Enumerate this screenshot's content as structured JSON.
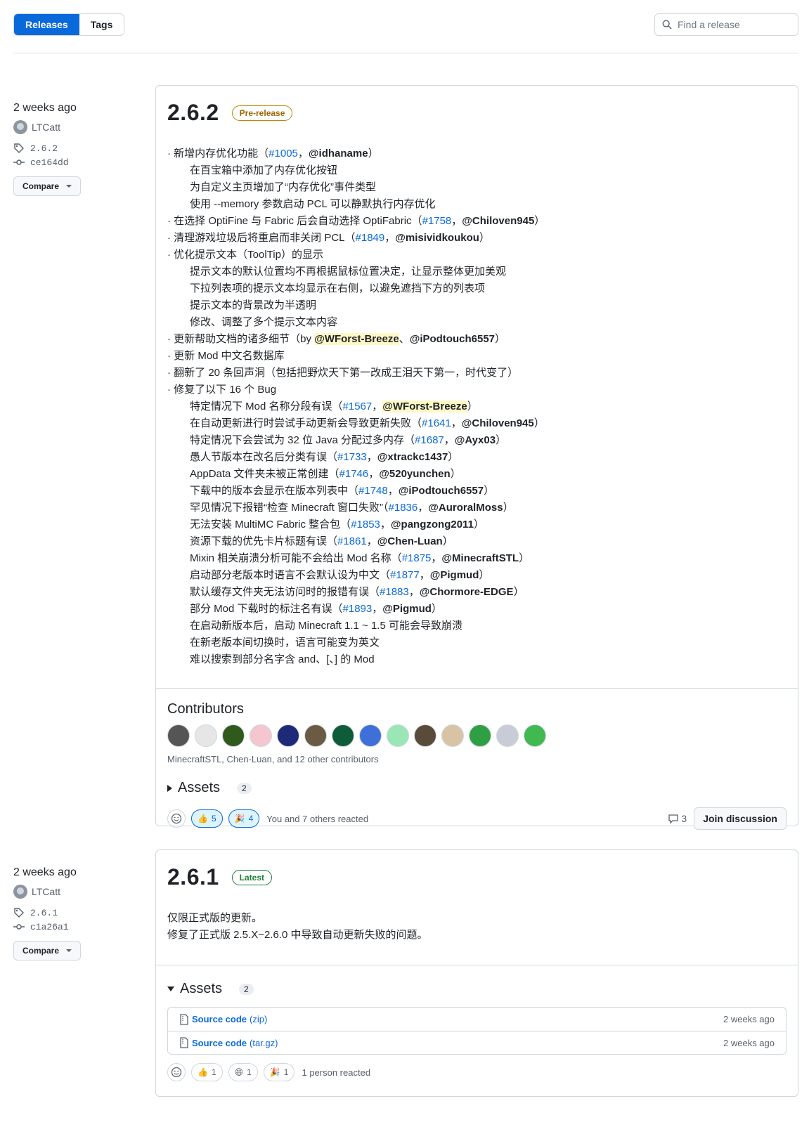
{
  "tabs": {
    "releases": "Releases",
    "tags": "Tags"
  },
  "search": {
    "placeholder": "Find a release"
  },
  "r1": {
    "time": "2 weeks ago",
    "author": "LTCatt",
    "tag": "2.6.2",
    "commit": "ce164dd",
    "compare": "Compare",
    "version": "2.6.2",
    "badge": "Pre-release",
    "notes": [
      {
        "indent": false,
        "parts": [
          {
            "t": "· 新增内存优化功能（"
          },
          {
            "t": "#1005",
            "k": "link"
          },
          {
            "t": "，"
          },
          {
            "t": "@idhaname",
            "k": "user"
          },
          {
            "t": "）"
          }
        ]
      },
      {
        "indent": true,
        "parts": [
          {
            "t": "在百宝箱中添加了内存优化按钮"
          }
        ]
      },
      {
        "indent": true,
        "parts": [
          {
            "t": "为自定义主页增加了“内存优化”事件类型"
          }
        ]
      },
      {
        "indent": true,
        "parts": [
          {
            "t": "使用 --memory 参数启动 PCL 可以静默执行内存优化"
          }
        ]
      },
      {
        "indent": false,
        "parts": [
          {
            "t": "· 在选择 OptiFine 与 Fabric 后会自动选择 OptiFabric（"
          },
          {
            "t": "#1758",
            "k": "link"
          },
          {
            "t": "，"
          },
          {
            "t": "@Chiloven945",
            "k": "user"
          },
          {
            "t": "）"
          }
        ]
      },
      {
        "indent": false,
        "parts": [
          {
            "t": "· 清理游戏垃圾后将重启而非关闭 PCL（"
          },
          {
            "t": "#1849",
            "k": "link"
          },
          {
            "t": "，"
          },
          {
            "t": "@misividkoukou",
            "k": "user"
          },
          {
            "t": "）"
          }
        ]
      },
      {
        "indent": false,
        "parts": [
          {
            "t": "· 优化提示文本（ToolTip）的显示"
          }
        ]
      },
      {
        "indent": true,
        "parts": [
          {
            "t": "提示文本的默认位置均不再根据鼠标位置决定，让显示整体更加美观"
          }
        ]
      },
      {
        "indent": true,
        "parts": [
          {
            "t": "下拉列表项的提示文本均显示在右侧，以避免遮挡下方的列表项"
          }
        ]
      },
      {
        "indent": true,
        "parts": [
          {
            "t": "提示文本的背景改为半透明"
          }
        ]
      },
      {
        "indent": true,
        "parts": [
          {
            "t": "修改、调整了多个提示文本内容"
          }
        ]
      },
      {
        "indent": false,
        "parts": [
          {
            "t": "· 更新帮助文档的诸多细节（by "
          },
          {
            "t": "@WForst-Breeze",
            "k": "hl"
          },
          {
            "t": "、"
          },
          {
            "t": "@iPodtouch6557",
            "k": "user"
          },
          {
            "t": "）"
          }
        ]
      },
      {
        "indent": false,
        "parts": [
          {
            "t": "· 更新 Mod 中文名数据库"
          }
        ]
      },
      {
        "indent": false,
        "parts": [
          {
            "t": "· 翻新了 20 条回声洞（包括把野炊天下第一改成王泪天下第一，时代变了）"
          }
        ]
      },
      {
        "indent": false,
        "parts": [
          {
            "t": "· 修复了以下 16 个 Bug"
          }
        ]
      },
      {
        "indent": true,
        "parts": [
          {
            "t": "特定情况下 Mod 名称分段有误（"
          },
          {
            "t": "#1567",
            "k": "link"
          },
          {
            "t": "，"
          },
          {
            "t": "@WForst-Breeze",
            "k": "hl"
          },
          {
            "t": "）"
          }
        ]
      },
      {
        "indent": true,
        "parts": [
          {
            "t": "在自动更新进行时尝试手动更新会导致更新失败（"
          },
          {
            "t": "#1641",
            "k": "link"
          },
          {
            "t": "，"
          },
          {
            "t": "@Chiloven945",
            "k": "user"
          },
          {
            "t": "）"
          }
        ]
      },
      {
        "indent": true,
        "parts": [
          {
            "t": "特定情况下会尝试为 32 位 Java 分配过多内存（"
          },
          {
            "t": "#1687",
            "k": "link"
          },
          {
            "t": "，"
          },
          {
            "t": "@Ayx03",
            "k": "user"
          },
          {
            "t": "）"
          }
        ]
      },
      {
        "indent": true,
        "parts": [
          {
            "t": "愚人节版本在改名后分类有误（"
          },
          {
            "t": "#1733",
            "k": "link"
          },
          {
            "t": "，"
          },
          {
            "t": "@xtrackc1437",
            "k": "user"
          },
          {
            "t": "）"
          }
        ]
      },
      {
        "indent": true,
        "parts": [
          {
            "t": "AppData 文件夹未被正常创建（"
          },
          {
            "t": "#1746",
            "k": "link"
          },
          {
            "t": "，"
          },
          {
            "t": "@520yunchen",
            "k": "user"
          },
          {
            "t": "）"
          }
        ]
      },
      {
        "indent": true,
        "parts": [
          {
            "t": "下载中的版本会显示在版本列表中（"
          },
          {
            "t": "#1748",
            "k": "link"
          },
          {
            "t": "，"
          },
          {
            "t": "@iPodtouch6557",
            "k": "user"
          },
          {
            "t": "）"
          }
        ]
      },
      {
        "indent": true,
        "parts": [
          {
            "t": "罕见情况下报错“检查 Minecraft 窗口失败”（"
          },
          {
            "t": "#1836",
            "k": "link"
          },
          {
            "t": "，"
          },
          {
            "t": "@AuroralMoss",
            "k": "user"
          },
          {
            "t": "）"
          }
        ]
      },
      {
        "indent": true,
        "parts": [
          {
            "t": "无法安装 MultiMC Fabric 整合包（"
          },
          {
            "t": "#1853",
            "k": "link"
          },
          {
            "t": "，"
          },
          {
            "t": "@pangzong2011",
            "k": "user"
          },
          {
            "t": "）"
          }
        ]
      },
      {
        "indent": true,
        "parts": [
          {
            "t": "资源下载的优先卡片标题有误（"
          },
          {
            "t": "#1861",
            "k": "link"
          },
          {
            "t": "，"
          },
          {
            "t": "@Chen-Luan",
            "k": "user"
          },
          {
            "t": "）"
          }
        ]
      },
      {
        "indent": true,
        "parts": [
          {
            "t": "Mixin 相关崩溃分析可能不会给出 Mod 名称（"
          },
          {
            "t": "#1875",
            "k": "link"
          },
          {
            "t": "，"
          },
          {
            "t": "@MinecraftSTL",
            "k": "user"
          },
          {
            "t": "）"
          }
        ]
      },
      {
        "indent": true,
        "parts": [
          {
            "t": "启动部分老版本时语言不会默认设为中文（"
          },
          {
            "t": "#1877",
            "k": "link"
          },
          {
            "t": "，"
          },
          {
            "t": "@Pigmud",
            "k": "user"
          },
          {
            "t": "）"
          }
        ]
      },
      {
        "indent": true,
        "parts": [
          {
            "t": "默认缓存文件夹无法访问时的报错有误（"
          },
          {
            "t": "#1883",
            "k": "link"
          },
          {
            "t": "，"
          },
          {
            "t": "@Chormore-EDGE",
            "k": "user"
          },
          {
            "t": "）"
          }
        ]
      },
      {
        "indent": true,
        "parts": [
          {
            "t": "部分 Mod 下载时的标注名有误（"
          },
          {
            "t": "#1893",
            "k": "link"
          },
          {
            "t": "，"
          },
          {
            "t": "@Pigmud",
            "k": "user"
          },
          {
            "t": "）"
          }
        ]
      },
      {
        "indent": true,
        "parts": [
          {
            "t": "在启动新版本后，启动 Minecraft 1.1 ~ 1.5 可能会导致崩溃"
          }
        ]
      },
      {
        "indent": true,
        "parts": [
          {
            "t": "在新老版本间切换时，语言可能变为英文"
          }
        ]
      },
      {
        "indent": true,
        "parts": [
          {
            "t": "难以搜索到部分名字含 and、[、] 的 Mod"
          }
        ]
      }
    ],
    "contributors_title": "Contributors",
    "contributor_colors": [
      "#555",
      "#e6e6e6",
      "#2f5a1c",
      "#f3c6d0",
      "#1e2a78",
      "#6b5a44",
      "#0f5c3a",
      "#3f6fd8",
      "#9ae6b4",
      "#5a4a3a",
      "#d9c3a5",
      "#2ea043",
      "#c9ccd6",
      "#3fb950"
    ],
    "contributors_text": "MinecraftSTL, Chen-Luan, and 12 other contributors",
    "assets_label": "Assets",
    "assets_count": "2",
    "reactions": [
      {
        "emoji": "👍",
        "count": "5"
      },
      {
        "emoji": "🎉",
        "count": "4"
      }
    ],
    "reaction_text": "You and 7 others reacted",
    "comments": "3",
    "discussion": "Join discussion"
  },
  "r2": {
    "time": "2 weeks ago",
    "author": "LTCatt",
    "tag": "2.6.1",
    "commit": "c1a26a1",
    "compare": "Compare",
    "version": "2.6.1",
    "badge": "Latest",
    "line1": "仅限正式版的更新。",
    "line2": "修复了正式版 2.5.X~2.6.0 中导致自动更新失败的问题。",
    "assets_label": "Assets",
    "assets_count": "2",
    "assets": [
      {
        "name": "Source code",
        "ext": "(zip)",
        "time": "2 weeks ago"
      },
      {
        "name": "Source code",
        "ext": "(tar.gz)",
        "time": "2 weeks ago"
      }
    ],
    "reactions": [
      {
        "emoji": "👍",
        "count": "1"
      },
      {
        "emoji": "😄",
        "count": "1"
      },
      {
        "emoji": "🎉",
        "count": "1"
      }
    ],
    "reaction_text": "1 person reacted"
  }
}
